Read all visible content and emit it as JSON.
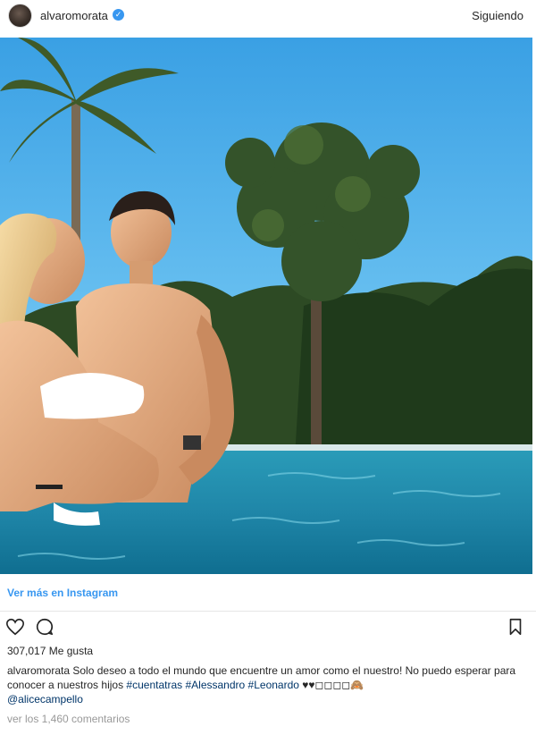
{
  "post": {
    "username": "alvaromorata",
    "follow_label": "Siguiendo",
    "view_more_label": "Ver más en Instagram",
    "likes_label": "307,017 Me gusta",
    "caption_user": "alvaromorata",
    "caption_text": "Solo deseo a todo el mundo que encuentre un amor como el nuestro! No puedo esperar para conocer a nuestros hijos",
    "hashtags": [
      "#cuentatras",
      "#Alessandro",
      "#Leonardo"
    ],
    "emoji_tail": "♥♥◻◻◻◻🙈",
    "mention": "@alicecampello",
    "comments_label": "ver los 1,460 comentarios"
  },
  "colors": {
    "link": "#3897f0",
    "hashtag": "#003569",
    "muted": "#999999",
    "verified": "#3897f0"
  },
  "icons": {
    "verified": "verified-badge-icon",
    "like": "heart-icon",
    "comment": "comment-icon",
    "save": "bookmark-icon"
  }
}
